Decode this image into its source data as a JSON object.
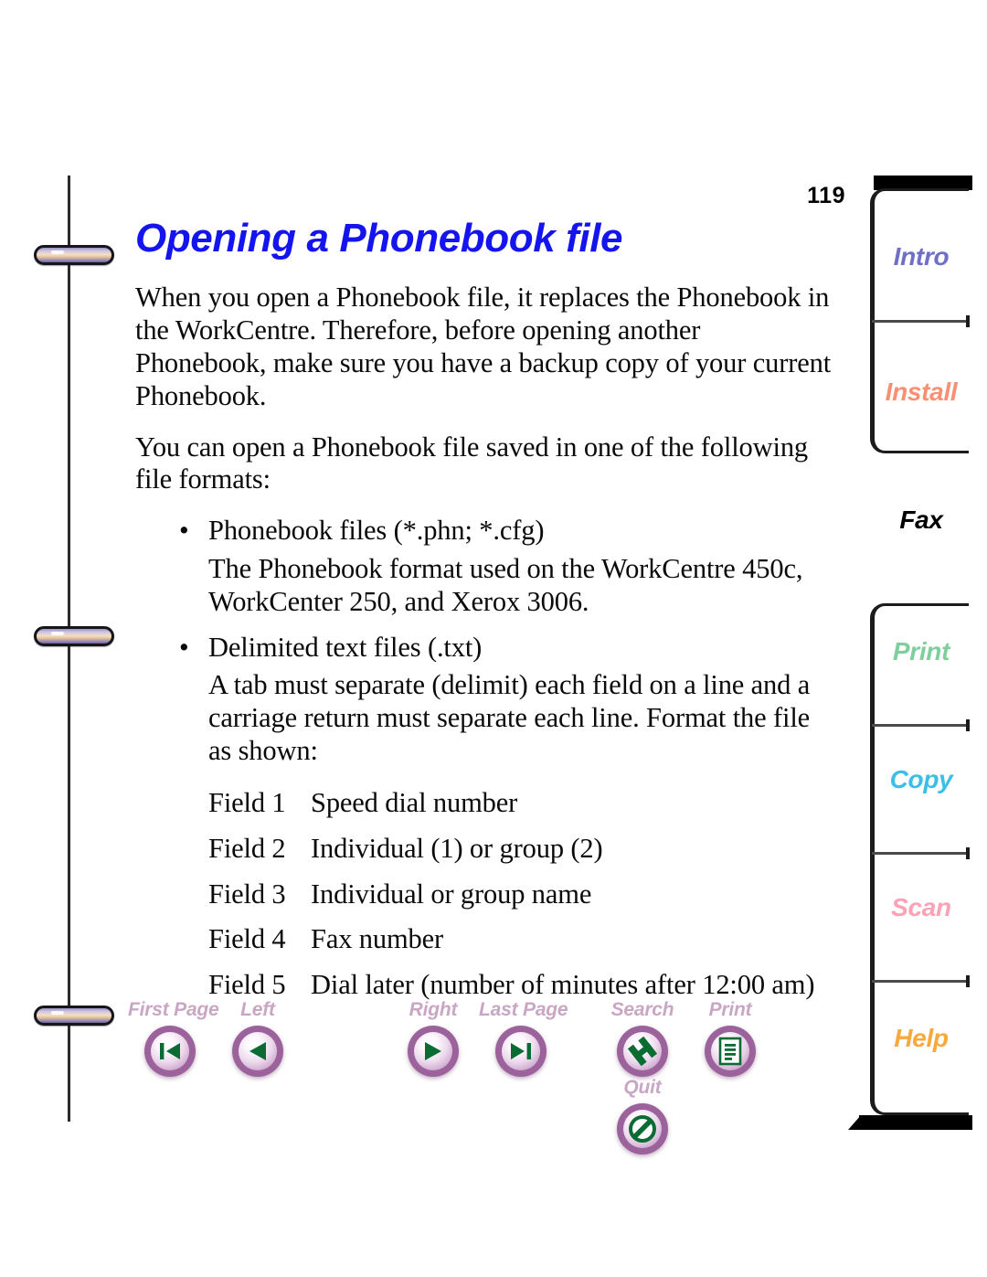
{
  "page": {
    "number": "119",
    "title": "Opening a Phonebook file"
  },
  "body": {
    "paragraph_1": "When you open a Phonebook file, it replaces the Phonebook in the WorkCentre. Therefore, before opening another Phonebook, make sure you have a backup copy of your current Phonebook.",
    "paragraph_2": "You can open a Phonebook file saved in one of the following file formats:",
    "bullet_char": "•",
    "bullets": [
      {
        "label": "Phonebook files (*.phn; *.cfg)",
        "detail": "The Phonebook format used on the WorkCentre 450c, WorkCenter 250, and Xerox 3006."
      },
      {
        "label": "Delimited text files (.txt)",
        "detail": "A tab must separate (delimit) each field on a line and a carriage return must separate each line. Format the file as shown:"
      }
    ],
    "fields": [
      {
        "name": "Field 1",
        "description": "Speed dial number"
      },
      {
        "name": "Field 2",
        "description": "Individual (1) or group (2)"
      },
      {
        "name": "Field 3",
        "description": "Individual or group name"
      },
      {
        "name": "Field 4",
        "description": "Fax number"
      },
      {
        "name": "Field 5",
        "description": "Dial later (number of minutes after 12:00 am)"
      }
    ]
  },
  "navbar": {
    "left_group": [
      {
        "label": "First Page",
        "icon": "first-page-icon"
      },
      {
        "label": "Left",
        "icon": "previous-page-icon"
      }
    ],
    "right_group_arrows": [
      {
        "label": "Right",
        "icon": "next-page-icon"
      },
      {
        "label": "Last Page",
        "icon": "last-page-icon"
      }
    ],
    "actions": [
      {
        "label": "Search",
        "icon": "search-icon"
      },
      {
        "label": "Print",
        "icon": "print-icon"
      },
      {
        "label": "Quit",
        "icon": "quit-icon"
      }
    ],
    "label_color": "#c9a7c4",
    "glyph_color": "#0a6b33"
  },
  "tabs": {
    "upper": [
      {
        "label": "Intro",
        "color": "#6f6fc8"
      },
      {
        "label": "Install",
        "color": "#f99074"
      }
    ],
    "active": {
      "label": "Fax",
      "color": "#000000"
    },
    "lower": [
      {
        "label": "Print",
        "color": "#7ecf9b"
      },
      {
        "label": "Copy",
        "color": "#3bbfe8"
      },
      {
        "label": "Scan",
        "color": "#fba3b6"
      },
      {
        "label": "Help",
        "color": "#f9a83c"
      }
    ]
  }
}
